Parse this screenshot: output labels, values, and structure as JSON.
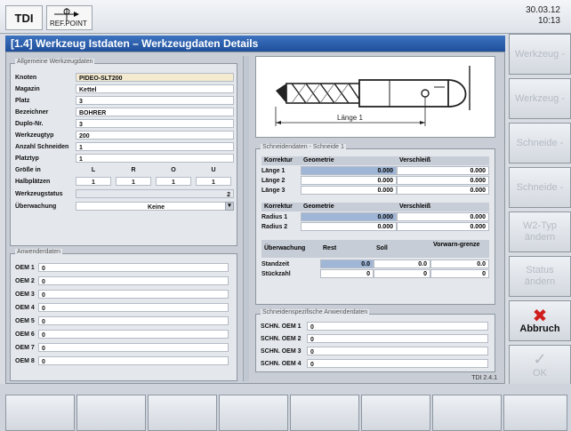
{
  "mode": "TDI",
  "ref_point": "REF.POINT",
  "clock": {
    "date": "30.03.12",
    "time": "10:13"
  },
  "title": "[1.4] Werkzeug Istdaten – Werkzeugdaten Details",
  "general": {
    "section_label": "Allgemeine Werkzeugdaten",
    "rows": [
      {
        "label": "Knoten",
        "value": "PIDEO-SLT200"
      },
      {
        "label": "Magazin",
        "value": "Kettel"
      },
      {
        "label": "Platz",
        "value": "3"
      },
      {
        "label": "Bezeichner",
        "value": "BOHRER"
      },
      {
        "label": "Duplo-Nr.",
        "value": "3"
      },
      {
        "label": "Werkzeugtyp",
        "value": "200"
      },
      {
        "label": "Anzahl Schneiden",
        "value": "1"
      },
      {
        "label": "Platztyp",
        "value": "1"
      }
    ],
    "groesse_label": "Größe in",
    "groesse_values": [
      "L",
      "R",
      "O",
      "U"
    ],
    "halbplaetze_label": "Halbplätzen",
    "halbplaetze_values": [
      "1",
      "1",
      "1",
      "1"
    ],
    "status_label": "Werkzeugstatus",
    "status_value": "2",
    "ueberwachung_label": "Überwachung",
    "ueberwachung_value": "Keine"
  },
  "user_data": {
    "section_label": "Anwenderdaten",
    "rows": [
      {
        "label": "OEM 1",
        "value": "0"
      },
      {
        "label": "OEM 2",
        "value": "0"
      },
      {
        "label": "OEM 3",
        "value": "0"
      },
      {
        "label": "OEM 4",
        "value": "0"
      },
      {
        "label": "OEM 5",
        "value": "0"
      },
      {
        "label": "OEM 6",
        "value": "0"
      },
      {
        "label": "OEM 7",
        "value": "0"
      },
      {
        "label": "OEM 8",
        "value": "0"
      }
    ]
  },
  "drawing": {
    "length_label": "Länge 1"
  },
  "cutting": {
    "section_label": "Schneidendaten - Schneide 1",
    "header": [
      "Korrektur",
      "Geometrie",
      "Verschleiß"
    ],
    "length_rows": [
      {
        "label": "Länge 1",
        "geo": "0.000",
        "wear": "0.000"
      },
      {
        "label": "Länge 2",
        "geo": "0.000",
        "wear": "0.000"
      },
      {
        "label": "Länge 3",
        "geo": "0.000",
        "wear": "0.000"
      }
    ],
    "radius_rows": [
      {
        "label": "Radius 1",
        "geo": "0.000",
        "wear": "0.000"
      },
      {
        "label": "Radius 2",
        "geo": "0.000",
        "wear": "0.000"
      }
    ],
    "monitor_header": [
      "Überwachung",
      "Rest",
      "Soll",
      "Vorwarn-grenze"
    ],
    "monitor_rows": [
      {
        "label": "Standzeit",
        "rest": "0.0",
        "soll": "0.0",
        "warn": "0.0"
      },
      {
        "label": "Stückzahl",
        "rest": "0",
        "soll": "0",
        "warn": "0"
      }
    ]
  },
  "edge_user": {
    "section_label": "Schneidenspezifische Anwenderdaten",
    "rows": [
      {
        "label": "SCHN. OEM 1",
        "value": "0"
      },
      {
        "label": "SCHN. OEM 2",
        "value": "0"
      },
      {
        "label": "SCHN. OEM 3",
        "value": "0"
      },
      {
        "label": "SCHN. OEM 4",
        "value": "0"
      }
    ]
  },
  "version": "TDI 2.4.1",
  "softkeys": [
    {
      "label": "Werkzeug -",
      "enabled": false
    },
    {
      "label": "Werkzeug -",
      "enabled": false
    },
    {
      "label": "Schneide -",
      "enabled": false
    },
    {
      "label": "Schneide -",
      "enabled": false
    },
    {
      "label": "W2-Typ ändern",
      "enabled": false
    },
    {
      "label": "Status ändern",
      "enabled": false
    },
    {
      "label": "Abbruch",
      "enabled": true
    },
    {
      "label": "OK",
      "enabled": false
    }
  ],
  "colors": {
    "title_bg": "#1f4f9b",
    "cancel_icon": "#d01e1e",
    "highlight": "#9fb6d7"
  }
}
